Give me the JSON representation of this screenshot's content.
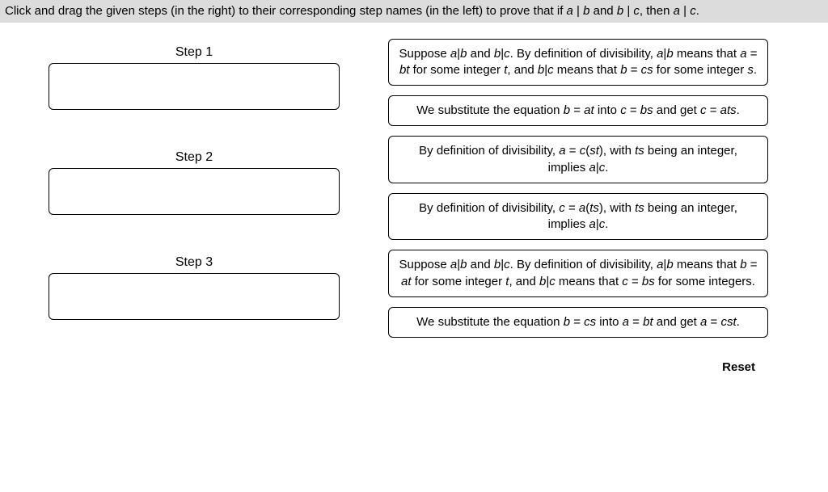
{
  "instruction": {
    "prefix": "Click and drag the given steps (in the right) to their corresponding step names (in the left) to prove that if ",
    "expr1_a": "a",
    "expr1_mid": " | ",
    "expr1_b": "b",
    "and1": " and ",
    "expr2_b": "b",
    "expr2_mid": " | ",
    "expr2_c": "c",
    "then": ", then ",
    "expr3_a": "a",
    "expr3_mid": " | ",
    "expr3_c": "c",
    "end": "."
  },
  "steps": [
    {
      "label": "Step 1"
    },
    {
      "label": "Step 2"
    },
    {
      "label": "Step 3"
    }
  ],
  "cards": [
    {
      "t1": "Suppose ",
      "i1": "a",
      "t2": "|",
      "i2": "b",
      "t3": " and ",
      "i3": "b",
      "t4": "|",
      "i4": "c",
      "t5": ". By definition of divisibility, ",
      "i5": "a",
      "t6": "|",
      "i6": "b",
      "t7": " means that ",
      "i7": "a",
      "t8": " = ",
      "i8": "bt",
      "t9": " for some integer ",
      "i9": "t",
      "t10": ", and ",
      "i10": "b",
      "t11": "|",
      "i11": "c",
      "t12": " means that ",
      "i12": "b",
      "t13": " = ",
      "i13": "cs",
      "t14": " for some integer ",
      "i14": "s",
      "t15": "."
    },
    {
      "t1": "We substitute the equation ",
      "i1": "b",
      "t2": " = ",
      "i2": "at",
      "t3": " into ",
      "i3": "c",
      "t4": " = ",
      "i4": "bs",
      "t5": " and get ",
      "i5": "c",
      "t6": " = ",
      "i6": "ats",
      "t7": "."
    },
    {
      "t1": "By definition of divisibility, ",
      "i1": "a",
      "t2": " = ",
      "i2": "c",
      "t3": "(",
      "i3": "st",
      "t4": "), with ",
      "i4": "ts",
      "t5": " being an integer, implies ",
      "i5": "a",
      "t6": "|",
      "i6": "c",
      "t7": "."
    },
    {
      "t1": "By definition of divisibility, ",
      "i1": "c",
      "t2": " = ",
      "i2": "a",
      "t3": "(",
      "i3": "ts",
      "t4": "), with ",
      "i4": "ts",
      "t5": " being an integer, implies ",
      "i5": "a",
      "t6": "|",
      "i6": "c",
      "t7": "."
    },
    {
      "t1": "Suppose ",
      "i1": "a",
      "t2": "|",
      "i2": "b",
      "t3": " and ",
      "i3": "b",
      "t4": "|",
      "i4": "c",
      "t5": ". By definition of divisibility, ",
      "i5": "a",
      "t6": "|",
      "i6": "b",
      "t7": " means that ",
      "i7": "b",
      "t8": " = ",
      "i8": "at",
      "t9": " for some integer ",
      "i9": "t",
      "t10": ", and ",
      "i10": "b",
      "t11": "|",
      "i11": "c",
      "t12": " means that ",
      "i12": "c",
      "t13": " = ",
      "i13": "bs",
      "t14": " for some integers."
    },
    {
      "t1": "We substitute the equation ",
      "i1": "b",
      "t2": " = ",
      "i2": "cs",
      "t3": " into ",
      "i3": "a",
      "t4": " = ",
      "i4": "bt",
      "t5": " and get ",
      "i5": "a",
      "t6": " = ",
      "i6": "cst",
      "t7": "."
    }
  ],
  "reset_label": "Reset"
}
